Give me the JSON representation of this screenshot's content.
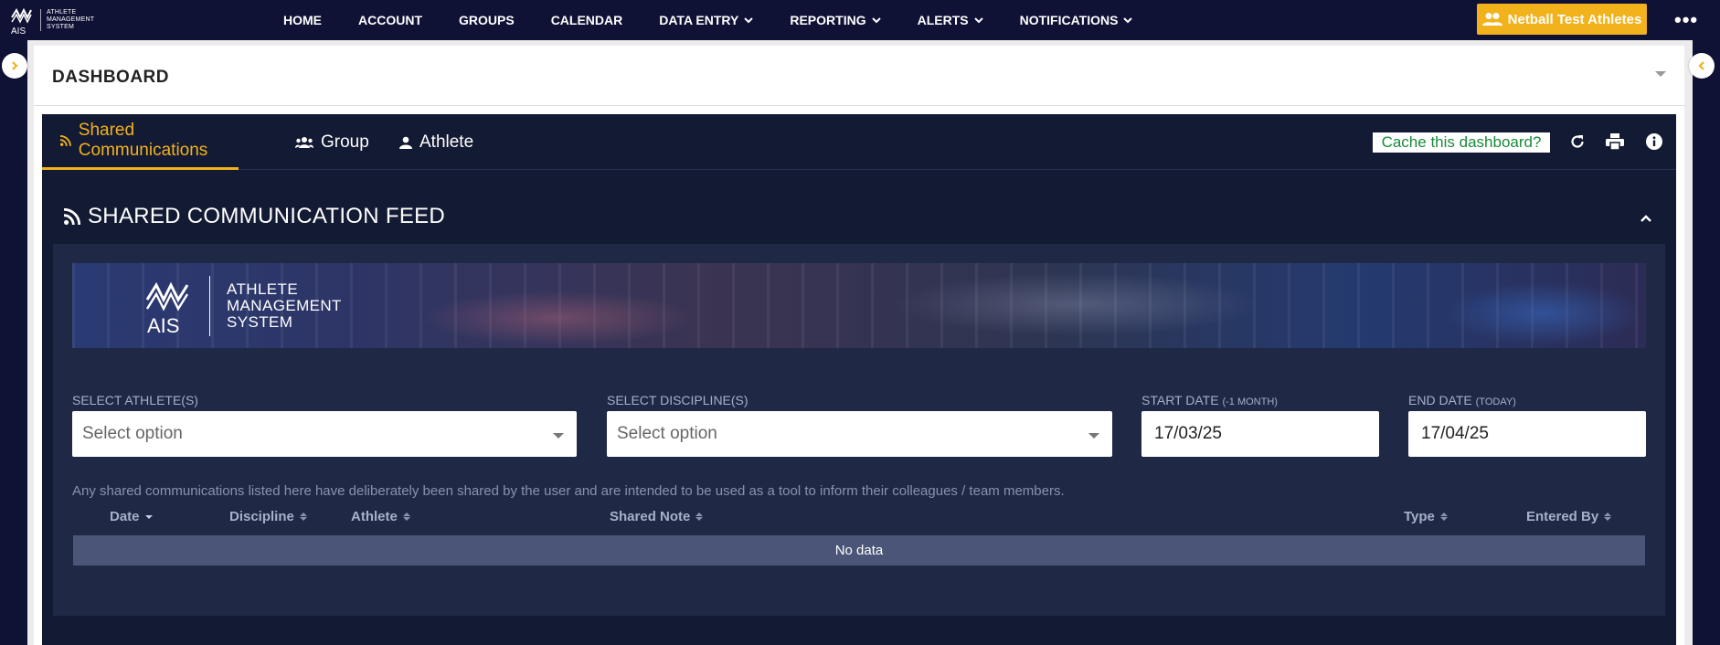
{
  "logo": {
    "abbr": "AIS",
    "line1": "ATHLETE",
    "line2": "MANAGEMENT",
    "line3": "SYSTEM"
  },
  "nav": {
    "home": "HOME",
    "account": "ACCOUNT",
    "groups": "GROUPS",
    "calendar": "CALENDAR",
    "data_entry": "DATA ENTRY",
    "reporting": "REPORTING",
    "alerts": "ALERTS",
    "notifications": "NOTIFICATIONS"
  },
  "team_button": "Netball Test Athletes",
  "more_menu": "•••",
  "dashboard": {
    "title": "DASHBOARD"
  },
  "tabs": {
    "shared": "Shared Communications",
    "group": "Group",
    "athlete": "Athlete"
  },
  "tools": {
    "cache": "Cache this dashboard?"
  },
  "feed": {
    "title": "SHARED COMMUNICATION FEED",
    "banner": {
      "abbr": "AIS",
      "line1": "ATHLETE",
      "line2": "MANAGEMENT",
      "line3": "SYSTEM"
    },
    "filters": {
      "athletes_label": "SELECT ATHLETE(S)",
      "athletes_value": "Select option",
      "disciplines_label": "SELECT DISCIPLINE(S)",
      "disciplines_value": "Select option",
      "start_label": "START DATE",
      "start_hint": "(-1 MONTH)",
      "start_value": "17/03/25",
      "end_label": "END DATE",
      "end_hint": "(TODAY)",
      "end_value": "17/04/25"
    },
    "note": "Any shared communications listed here have deliberately been shared by the user and are intended to be used as a tool to inform their colleagues / team members.",
    "columns": {
      "date": "Date",
      "discipline": "Discipline",
      "athlete": "Athlete",
      "shared_note": "Shared Note",
      "type": "Type",
      "entered_by": "Entered By"
    },
    "empty": "No data"
  },
  "colors": {
    "navy": "#0f1235",
    "accent": "#f2b21c",
    "panel": "#131a33",
    "inner": "#1f2845",
    "cache_text": "#1a8a3a"
  },
  "icons": [
    "rss-icon",
    "group-icon",
    "person-icon",
    "refresh-icon",
    "print-icon",
    "info-icon",
    "chevron-down-icon",
    "chevron-up-icon",
    "chevron-right-icon",
    "chevron-left-icon",
    "people-icon"
  ]
}
